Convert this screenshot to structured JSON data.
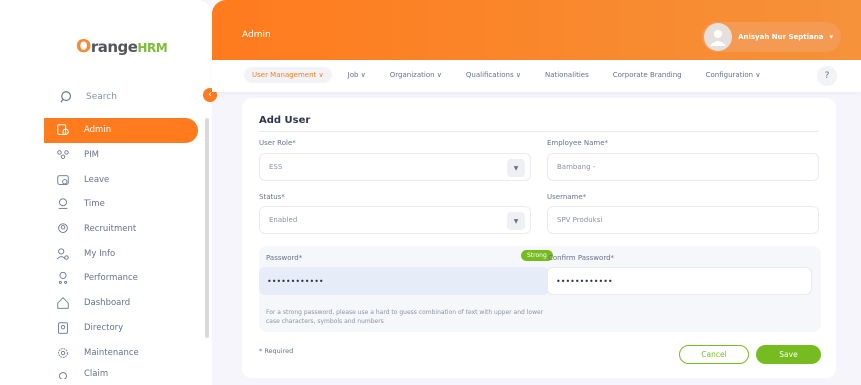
{
  "brand": {
    "o": "O",
    "name": "range",
    "hrm": "HRM"
  },
  "search": {
    "label": "Search"
  },
  "nav": {
    "items": [
      {
        "label": "Admin",
        "icon": "admin-icon",
        "active": true
      },
      {
        "label": "PIM",
        "icon": "pim-icon"
      },
      {
        "label": "Leave",
        "icon": "leave-icon"
      },
      {
        "label": "Time",
        "icon": "time-icon"
      },
      {
        "label": "Recruitment",
        "icon": "recruitment-icon"
      },
      {
        "label": "My Info",
        "icon": "my-info-icon"
      },
      {
        "label": "Performance",
        "icon": "performance-icon"
      },
      {
        "label": "Dashboard",
        "icon": "dashboard-icon"
      },
      {
        "label": "Directory",
        "icon": "directory-icon"
      },
      {
        "label": "Maintenance",
        "icon": "maintenance-icon"
      },
      {
        "label": "Claim",
        "icon": "claim-icon"
      }
    ]
  },
  "header": {
    "title": "Admin",
    "user_name": "Anisyah Nur Septiana",
    "user_caret": "▾"
  },
  "menu": {
    "items": [
      {
        "label": "User Management ∨",
        "active": true
      },
      {
        "label": "Job ∨"
      },
      {
        "label": "Organization ∨"
      },
      {
        "label": "Qualifications ∨"
      },
      {
        "label": "Nationalities"
      },
      {
        "label": "Corporate Branding"
      },
      {
        "label": "Configuration ∨"
      }
    ],
    "help": "?"
  },
  "form": {
    "title": "Add User",
    "user_role": {
      "label": "User Role*",
      "value": "ESS"
    },
    "employee_name": {
      "label": "Employee Name*",
      "value": "Bambang  -"
    },
    "status": {
      "label": "Status*",
      "value": "Enabled"
    },
    "username": {
      "label": "Username*",
      "value": "SPV Produksi"
    },
    "password": {
      "label": "Password*",
      "value": "••••••••••••",
      "strength": "Strong"
    },
    "confirm_password": {
      "label": "Confirm Password*",
      "value": "••••••••••••"
    },
    "hint": "For a strong password, please use a hard to guess combination of text with upper and lower case characters, symbols and numbers",
    "required_note": "* Required",
    "cancel_label": "Cancel",
    "save_label": "Save",
    "select_caret": "▼"
  },
  "colors": {
    "accent": "#ff7b1d",
    "green": "#76bc21"
  }
}
